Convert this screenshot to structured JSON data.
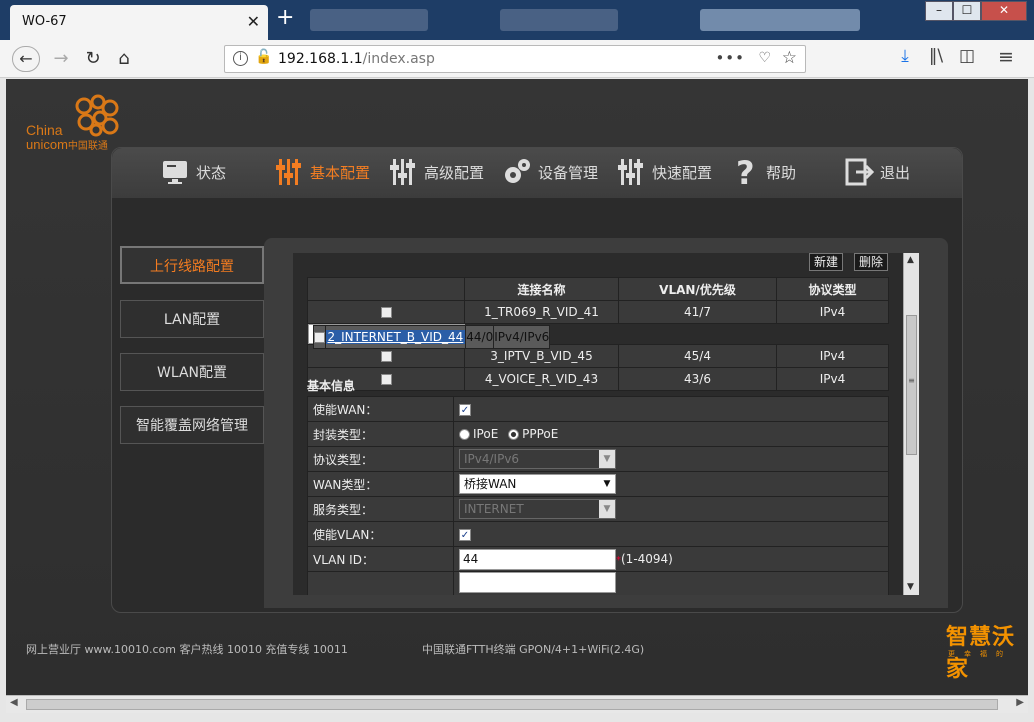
{
  "browser": {
    "tab_title": "WO-67",
    "tab_close": "✕",
    "new_tab": "+",
    "url_host": "192.168.1.1",
    "url_path": "/index.asp",
    "window_min": "–",
    "window_max": "☐",
    "window_close": "✕"
  },
  "logo": {
    "line1": "China",
    "line2": "unicom",
    "line2_cn": "中国联通"
  },
  "menu": [
    {
      "label": "状态",
      "icon": "monitor-icon"
    },
    {
      "label": "基本配置",
      "icon": "sliders-icon",
      "active": true
    },
    {
      "label": "高级配置",
      "icon": "sliders-icon"
    },
    {
      "label": "设备管理",
      "icon": "gears-icon"
    },
    {
      "label": "快速配置",
      "icon": "sliders-icon"
    },
    {
      "label": "帮助",
      "icon": "question-icon"
    },
    {
      "label": "退出",
      "icon": "exit-icon"
    }
  ],
  "sidebar": [
    {
      "label": "上行线路配置",
      "active": true
    },
    {
      "label": "LAN配置"
    },
    {
      "label": "WLAN配置"
    },
    {
      "label": "智能覆盖网络管理"
    }
  ],
  "actions": {
    "new": "新建",
    "delete": "删除"
  },
  "conn_table": {
    "headers": [
      "连接名称",
      "VLAN/优先级",
      "协议类型"
    ],
    "rows": [
      {
        "name": "1_TR069_R_VID_41",
        "vlan": "41/7",
        "proto": "IPv4"
      },
      {
        "name": "2_INTERNET_B_VID_44",
        "vlan": "44/0",
        "proto": "IPv4/IPv6"
      },
      {
        "name": "3_IPTV_B_VID_45",
        "vlan": "45/4",
        "proto": "IPv4"
      },
      {
        "name": "4_VOICE_R_VID_43",
        "vlan": "43/6",
        "proto": "IPv4"
      }
    ]
  },
  "basic": {
    "title": "基本信息",
    "enable_wan_label": "使能WAN：",
    "encap_label": "封装类型：",
    "encap_ipoe": "IPoE",
    "encap_pppoe": "PPPoE",
    "proto_label": "协议类型：",
    "proto_value": "IPv4/IPv6",
    "wan_type_label": "WAN类型：",
    "wan_type_value": "桥接WAN",
    "service_label": "服务类型：",
    "service_value": "INTERNET",
    "enable_vlan_label": "使能VLAN：",
    "vlan_id_label": "VLAN ID：",
    "vlan_id_value": "44",
    "vlan_id_hint": "(1-4094)"
  },
  "footer": {
    "left": "网上营业厅 www.10010.com   客户热线 10010   充值专线 10011",
    "middle": "中国联通FTTH终端 GPON/4+1+WiFi(2.4G)",
    "brand": "智慧沃家",
    "brand_sub": "更幸福的"
  }
}
